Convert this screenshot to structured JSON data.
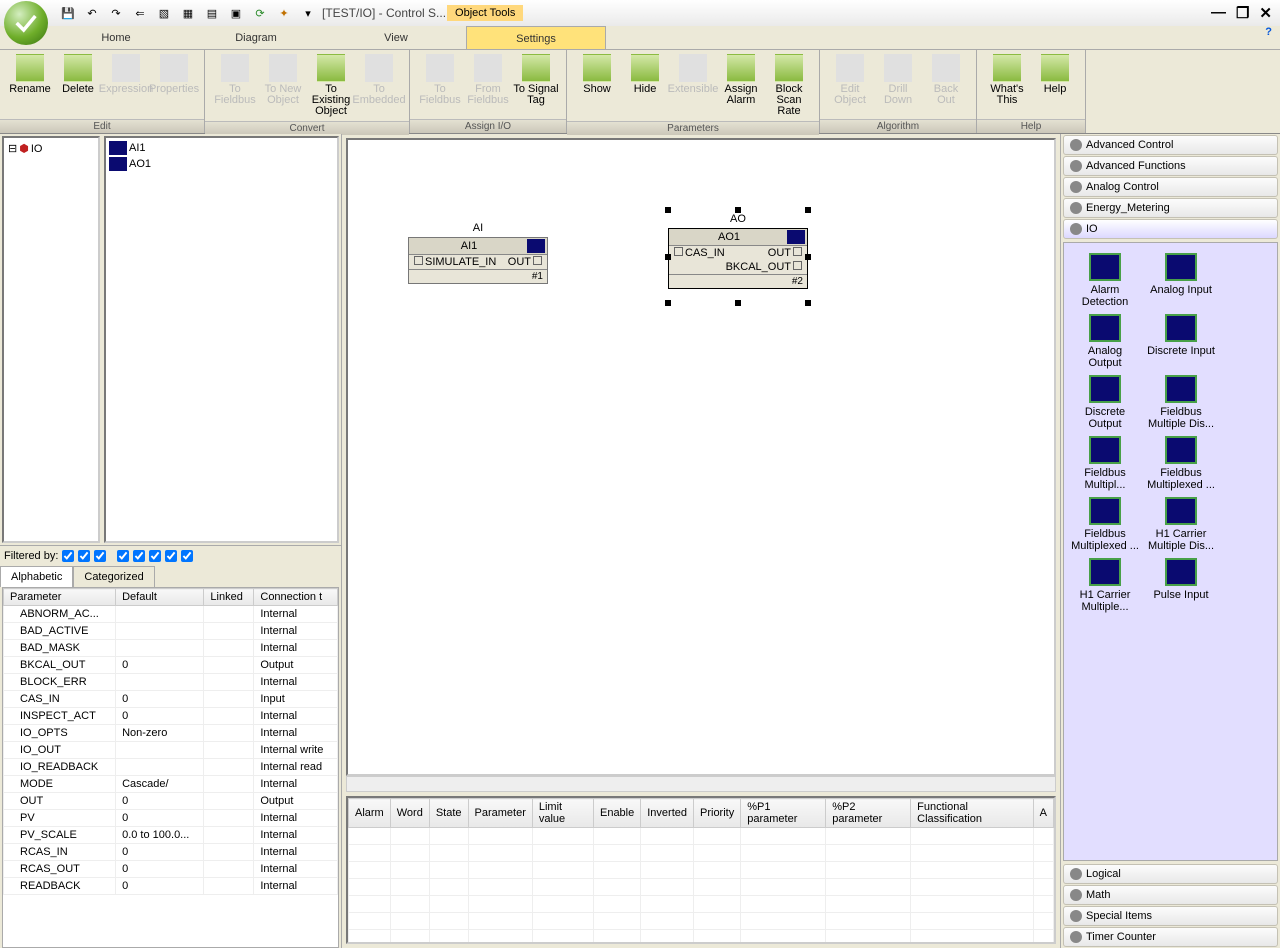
{
  "title": "[TEST/IO] - Control S...",
  "objectTools": "Object Tools",
  "tabs": [
    "Home",
    "Diagram",
    "View",
    "Settings"
  ],
  "activeTab": 3,
  "ribbonGroups": [
    {
      "label": "Edit",
      "buttons": [
        {
          "name": "rename",
          "label": "Rename",
          "enabled": true
        },
        {
          "name": "delete",
          "label": "Delete",
          "enabled": true
        },
        {
          "name": "expression",
          "label": "Expression",
          "enabled": false
        },
        {
          "name": "properties",
          "label": "Properties",
          "enabled": false
        }
      ]
    },
    {
      "label": "Convert",
      "buttons": [
        {
          "name": "to-fieldbus",
          "label": "To\nFieldbus",
          "enabled": false
        },
        {
          "name": "to-new-object",
          "label": "To New\nObject",
          "enabled": false
        },
        {
          "name": "to-existing-object",
          "label": "To Existing\nObject",
          "enabled": true
        },
        {
          "name": "to-embedded",
          "label": "To\nEmbedded",
          "enabled": false
        }
      ]
    },
    {
      "label": "Assign I/O",
      "buttons": [
        {
          "name": "to-fieldbus2",
          "label": "To\nFieldbus",
          "enabled": false
        },
        {
          "name": "from-fieldbus",
          "label": "From\nFieldbus",
          "enabled": false
        },
        {
          "name": "to-signal-tag",
          "label": "To Signal\nTag",
          "enabled": true
        }
      ]
    },
    {
      "label": "Parameters",
      "buttons": [
        {
          "name": "show",
          "label": "Show",
          "enabled": true
        },
        {
          "name": "hide",
          "label": "Hide",
          "enabled": true
        },
        {
          "name": "extensible",
          "label": "Extensible",
          "enabled": false
        },
        {
          "name": "assign-alarm",
          "label": "Assign\nAlarm",
          "enabled": true
        },
        {
          "name": "block-scan-rate",
          "label": "Block\nScan Rate",
          "enabled": true
        }
      ]
    },
    {
      "label": "Algorithm",
      "buttons": [
        {
          "name": "edit-object",
          "label": "Edit\nObject",
          "enabled": false
        },
        {
          "name": "drill-down",
          "label": "Drill\nDown",
          "enabled": false
        },
        {
          "name": "back-out",
          "label": "Back\nOut",
          "enabled": false
        }
      ]
    },
    {
      "label": "Help",
      "buttons": [
        {
          "name": "whats-this",
          "label": "What's\nThis",
          "enabled": true
        },
        {
          "name": "help",
          "label": "Help",
          "enabled": true
        }
      ]
    }
  ],
  "tree": {
    "root": "IO"
  },
  "listItems": [
    "AI1",
    "AO1"
  ],
  "filterLabel": "Filtered by:",
  "propTabs": [
    "Alphabetic",
    "Categorized"
  ],
  "propCols": [
    "Parameter",
    "Default",
    "Linked",
    "Connection t"
  ],
  "propRows": [
    {
      "p": "ABNORM_AC...",
      "d": "",
      "l": "",
      "c": "Internal"
    },
    {
      "p": "BAD_ACTIVE",
      "d": "",
      "l": "",
      "c": "Internal"
    },
    {
      "p": "BAD_MASK",
      "d": "",
      "l": "",
      "c": "Internal"
    },
    {
      "p": "BKCAL_OUT",
      "d": "0",
      "l": "",
      "c": "Output"
    },
    {
      "p": "BLOCK_ERR",
      "d": "",
      "l": "",
      "c": "Internal"
    },
    {
      "p": "CAS_IN",
      "d": "0",
      "l": "",
      "c": "Input"
    },
    {
      "p": "INSPECT_ACT",
      "d": "0",
      "l": "",
      "c": "Internal"
    },
    {
      "p": "IO_OPTS",
      "d": "Non-zero",
      "l": "",
      "c": "Internal"
    },
    {
      "p": "IO_OUT",
      "d": "",
      "l": "",
      "c": "Internal write"
    },
    {
      "p": "IO_READBACK",
      "d": "",
      "l": "",
      "c": "Internal read"
    },
    {
      "p": "MODE",
      "d": "Cascade/",
      "l": "",
      "c": "Internal"
    },
    {
      "p": "OUT",
      "d": "0",
      "l": "",
      "c": "Output"
    },
    {
      "p": "PV",
      "d": "0",
      "l": "",
      "c": "Internal"
    },
    {
      "p": "PV_SCALE",
      "d": "0.0 to 100.0...",
      "l": "",
      "c": "Internal"
    },
    {
      "p": "RCAS_IN",
      "d": "0",
      "l": "",
      "c": "Internal"
    },
    {
      "p": "RCAS_OUT",
      "d": "0",
      "l": "",
      "c": "Internal"
    },
    {
      "p": "READBACK",
      "d": "0",
      "l": "",
      "c": "Internal"
    }
  ],
  "canvas": {
    "ai": {
      "title": "AI",
      "name": "AI1",
      "pins": [
        [
          "SIMULATE_IN",
          "OUT"
        ]
      ],
      "footer": "#1"
    },
    "ao": {
      "title": "AO",
      "name": "AO1",
      "pins": [
        [
          "CAS_IN",
          "OUT"
        ],
        [
          "",
          "BKCAL_OUT"
        ]
      ],
      "footer": "#2"
    }
  },
  "almCols": [
    "Alarm",
    "Word",
    "State",
    "Parameter",
    "Limit value",
    "Enable",
    "Inverted",
    "Priority",
    "%P1 parameter",
    "%P2 parameter",
    "Functional Classification",
    "A"
  ],
  "paletteTabs": [
    "Advanced Control",
    "Advanced Functions",
    "Analog Control",
    "Energy_Metering",
    "IO"
  ],
  "paletteItems": [
    "Alarm Detection",
    "Analog Input",
    "Analog Output",
    "Discrete Input",
    "Discrete Output",
    "Fieldbus Multiple Dis...",
    "Fieldbus Multipl...",
    "Fieldbus Multiplexed ...",
    "Fieldbus Multiplexed ...",
    "H1 Carrier Multiple Dis...",
    "H1 Carrier Multiple...",
    "Pulse Input"
  ],
  "paletteBottom": [
    "Logical",
    "Math",
    "Special Items",
    "Timer Counter"
  ]
}
